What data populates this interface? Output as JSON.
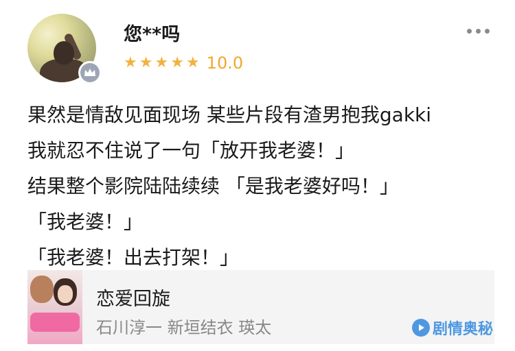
{
  "review": {
    "username": "您**吗",
    "score": "10.0",
    "star_count": 5,
    "star_color": "#f2b240",
    "lines": [
      "果然是情敌见面现场 某些片段有渣男抱我gakki",
      "我就忍不住说了一句「放开我老婆！」",
      "结果整个影院陆陆续续 「是我老婆好吗！」",
      "「我老婆！」",
      "「我老婆！出去打架！」"
    ]
  },
  "movie_card": {
    "title": "恋爱回旋",
    "cast": "石川淳一 新垣结衣 瑛太"
  },
  "watermark": {
    "text": "剧情奥秘"
  },
  "icons": {
    "avatar": "user-avatar",
    "badge": "crown-badge-icon",
    "more": "more-options-icon",
    "watermark": "play-logo-icon"
  }
}
